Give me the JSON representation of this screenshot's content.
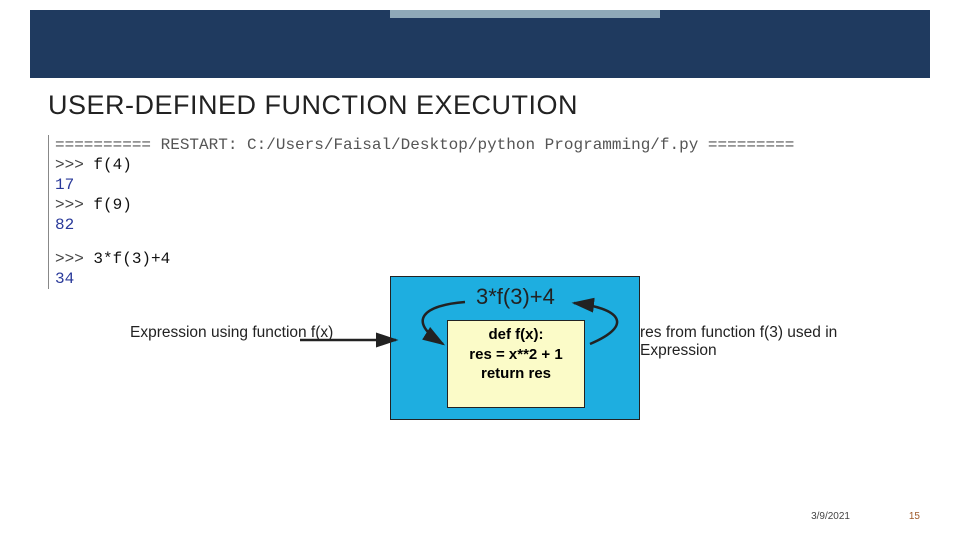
{
  "slide": {
    "title": "USER-DEFINED FUNCTION EXECUTION",
    "date": "3/9/2021",
    "page": "15"
  },
  "repl": {
    "restart_line": "========== RESTART: C:/Users/Faisal/Desktop/python Programming/f.py =========",
    "prompt": ">>> ",
    "call1": "f(4)",
    "out1": "17",
    "call2": "f(9)",
    "out2": "82",
    "call3": "3*f(3)+4",
    "out3": "34"
  },
  "diagram": {
    "expr": "3*f(3)+4",
    "def_line1": "def f(x):",
    "def_line2": "res = x**2 + 1",
    "def_line3": "return res",
    "left_label": "Expression using function f(x)",
    "right_label": "res from function f(3) used in Expression"
  }
}
